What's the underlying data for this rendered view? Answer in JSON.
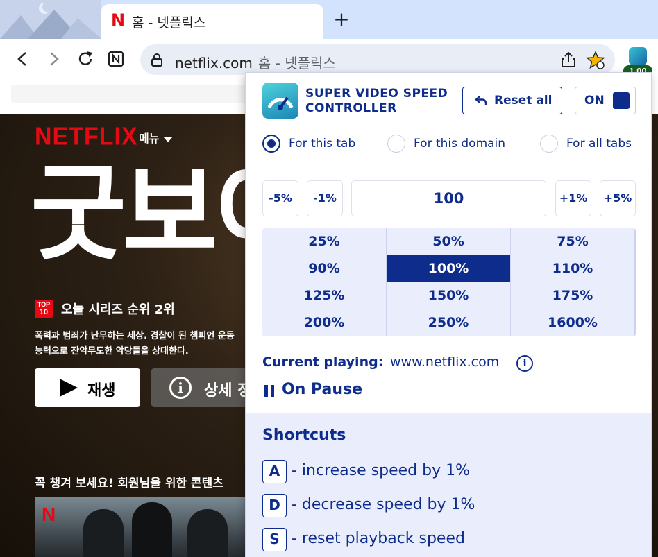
{
  "browser": {
    "tab_title": "홈 - 넷플릭스",
    "tab_favicon": "N",
    "newtab_label": "+",
    "url_host": "netflix.com",
    "url_title": "홈 - 넷플릭스",
    "extension_badge": "1.00"
  },
  "netflix": {
    "logo": "NETFLIX",
    "menu_label": "메뉴",
    "hero_title": "굿보이",
    "top10_badge_line1": "TOP",
    "top10_badge_line2": "10",
    "rank_text": "오늘 시리즈 순위 2위",
    "description_line1": "폭력과 범죄가 난무하는 세상. 경찰이 된 챔피언 운동",
    "description_line2": "능력으로 잔악무도한 악당들을 상대한다.",
    "play_label": "재생",
    "info_label": "상세 정보",
    "row_title": "꼭 챙겨 보세요! 회원님을 위한 콘텐츠",
    "thumb_logo": "N"
  },
  "popup": {
    "title_line1": "SUPER VIDEO SPEED",
    "title_line2": "CONTROLLER",
    "reset_label": "Reset all",
    "toggle_label": "ON",
    "scope_options": [
      {
        "label": "For this tab",
        "checked": true
      },
      {
        "label": "For this domain",
        "checked": false
      },
      {
        "label": "For all tabs",
        "checked": false
      }
    ],
    "step_buttons": {
      "minus5": "-5%",
      "minus1": "-1%",
      "plus1": "+1%",
      "plus5": "+5%"
    },
    "speed_value": "100",
    "presets": [
      "25%",
      "50%",
      "75%",
      "90%",
      "100%",
      "110%",
      "125%",
      "150%",
      "175%",
      "200%",
      "250%",
      "1600%"
    ],
    "active_preset": "100%",
    "current_playing_label": "Current playing:",
    "current_playing_host": "www.netflix.com",
    "info_glyph": "i",
    "status_label": "On Pause",
    "shortcuts_title": "Shortcuts",
    "shortcuts": [
      {
        "key": "A",
        "text": "- increase speed by 1%"
      },
      {
        "key": "D",
        "text": "- decrease speed by 1%"
      },
      {
        "key": "S",
        "text": "- reset playback speed"
      }
    ]
  },
  "colors": {
    "brand_navy": "#0d2c8c",
    "preset_bg": "#eaedfb",
    "netflix_red": "#e50914",
    "tabstrip_bg": "#d3e3fd"
  }
}
